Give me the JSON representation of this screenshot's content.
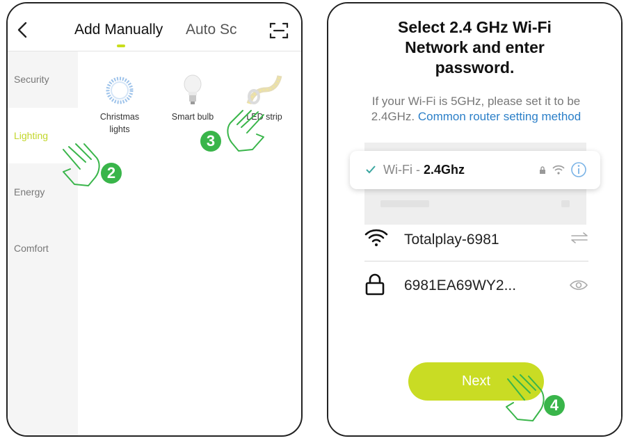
{
  "left_screen": {
    "tabs": [
      {
        "label": "Add Manually",
        "active": true
      },
      {
        "label": "Auto Sc",
        "active": false
      }
    ],
    "sidebar": {
      "items": [
        {
          "label": "Security"
        },
        {
          "label": "Lighting",
          "selected": true
        },
        {
          "label": "Energy"
        },
        {
          "label": "Comfort"
        }
      ]
    },
    "devices": [
      {
        "label": "Christmas lights",
        "icon": "christmas-lights-icon"
      },
      {
        "label": "Smart bulb",
        "icon": "smart-bulb-icon"
      },
      {
        "label": "LED strip",
        "icon": "led-strip-icon"
      }
    ],
    "step_badges": [
      "2",
      "3"
    ]
  },
  "right_screen": {
    "title": "Select 2.4 GHz Wi-Fi Network and enter password.",
    "subtitle": "If your Wi-Fi is 5GHz, please set it to be 2.4GHz.",
    "subtitle_link": "Common router setting method",
    "wifi_band_card": {
      "prefix": "Wi-Fi - ",
      "band": "2.4Ghz"
    },
    "network_name": "Totalplay-6981",
    "password": "6981EA69WY2...",
    "next_label": "Next",
    "step_badge": "4"
  },
  "colors": {
    "accent": "#c9dc24",
    "badge": "#39b54a",
    "link": "#2b7fc8"
  }
}
